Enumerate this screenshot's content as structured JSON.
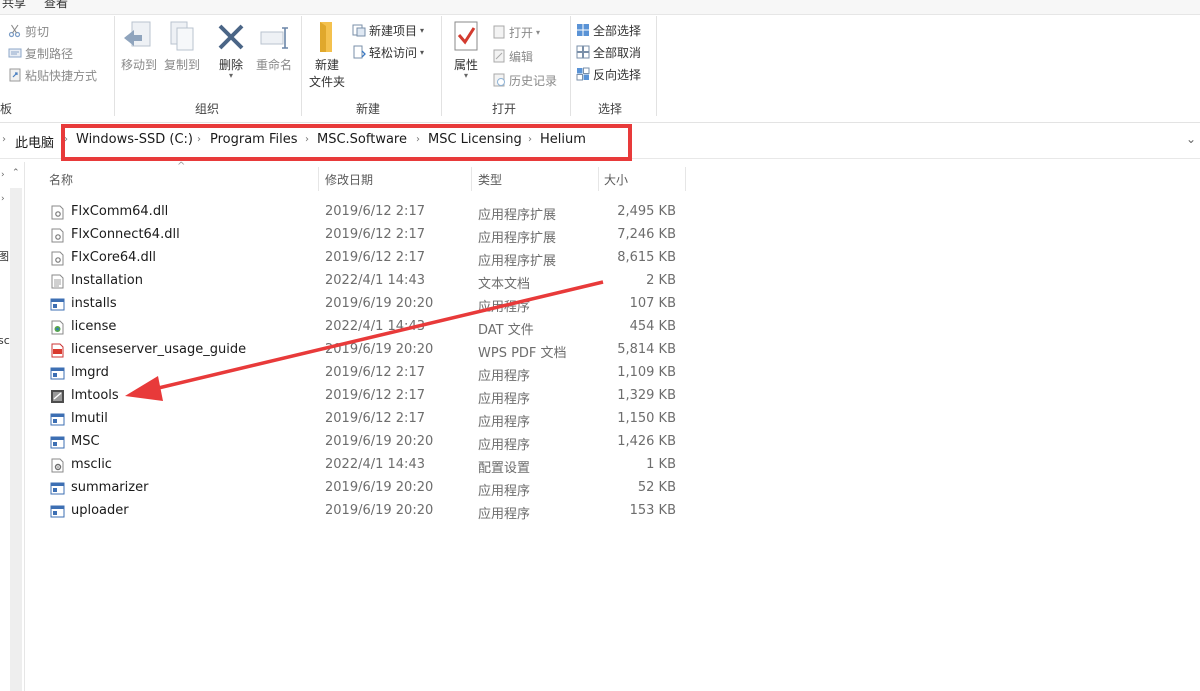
{
  "ribbon": {
    "tabs": [
      "共享",
      "查看"
    ],
    "left_cut_label": "板",
    "clipboard_small": [
      {
        "label": "剪切",
        "icon": "scissors-icon"
      },
      {
        "label": "复制路径",
        "icon": "copy-path-icon"
      },
      {
        "label": "粘贴快捷方式",
        "icon": "paste-shortcut-icon"
      }
    ],
    "organize": {
      "move_to": "移动到",
      "copy_to": "复制到",
      "delete": "删除",
      "rename": "重命名",
      "group_label": "组织"
    },
    "new": {
      "new_folder_line1": "新建",
      "new_folder_line2": "文件夹",
      "new_item": "新建项目",
      "easy_access": "轻松访问",
      "group_label": "新建"
    },
    "open": {
      "properties": "属性",
      "open": "打开",
      "edit": "编辑",
      "history": "历史记录",
      "group_label": "打开"
    },
    "select": {
      "select_all": "全部选择",
      "select_none": "全部取消",
      "invert": "反向选择",
      "group_label": "选择"
    }
  },
  "address": {
    "root": "此电脑",
    "crumbs": [
      "Windows-SSD (C:)",
      "Program Files",
      "MSC.Software",
      "MSC Licensing",
      "Helium"
    ]
  },
  "navpane": {
    "cut_labels": [
      "图",
      "sc"
    ]
  },
  "columns": {
    "name": "名称",
    "date": "修改日期",
    "type": "类型",
    "size": "大小"
  },
  "files": [
    {
      "name": "FlxComm64.dll",
      "date": "2019/6/12 2:17",
      "type": "应用程序扩展",
      "size": "2,495 KB",
      "icon": "dll-file-icon"
    },
    {
      "name": "FlxConnect64.dll",
      "date": "2019/6/12 2:17",
      "type": "应用程序扩展",
      "size": "7,246 KB",
      "icon": "dll-file-icon"
    },
    {
      "name": "FlxCore64.dll",
      "date": "2019/6/12 2:17",
      "type": "应用程序扩展",
      "size": "8,615 KB",
      "icon": "dll-file-icon"
    },
    {
      "name": "Installation",
      "date": "2022/4/1 14:43",
      "type": "文本文档",
      "size": "2 KB",
      "icon": "text-file-icon"
    },
    {
      "name": "installs",
      "date": "2019/6/19 20:20",
      "type": "应用程序",
      "size": "107 KB",
      "icon": "app-window-icon"
    },
    {
      "name": "license",
      "date": "2022/4/1 14:43",
      "type": "DAT 文件",
      "size": "454 KB",
      "icon": "dat-file-icon"
    },
    {
      "name": "licenseserver_usage_guide",
      "date": "2019/6/19 20:20",
      "type": "WPS PDF 文档",
      "size": "5,814 KB",
      "icon": "pdf-file-icon"
    },
    {
      "name": "lmgrd",
      "date": "2019/6/12 2:17",
      "type": "应用程序",
      "size": "1,109 KB",
      "icon": "app-window-icon"
    },
    {
      "name": "lmtools",
      "date": "2019/6/12 2:17",
      "type": "应用程序",
      "size": "1,329 KB",
      "icon": "lmtools-app-icon"
    },
    {
      "name": "lmutil",
      "date": "2019/6/12 2:17",
      "type": "应用程序",
      "size": "1,150 KB",
      "icon": "app-window-icon"
    },
    {
      "name": "MSC",
      "date": "2019/6/19 20:20",
      "type": "应用程序",
      "size": "1,426 KB",
      "icon": "app-window-icon"
    },
    {
      "name": "msclic",
      "date": "2022/4/1 14:43",
      "type": "配置设置",
      "size": "1 KB",
      "icon": "config-file-icon"
    },
    {
      "name": "summarizer",
      "date": "2019/6/19 20:20",
      "type": "应用程序",
      "size": "52 KB",
      "icon": "app-window-icon"
    },
    {
      "name": "uploader",
      "date": "2019/6/19 20:20",
      "type": "应用程序",
      "size": "153 KB",
      "icon": "app-window-icon"
    }
  ],
  "annotation_color": "#e83a3a"
}
